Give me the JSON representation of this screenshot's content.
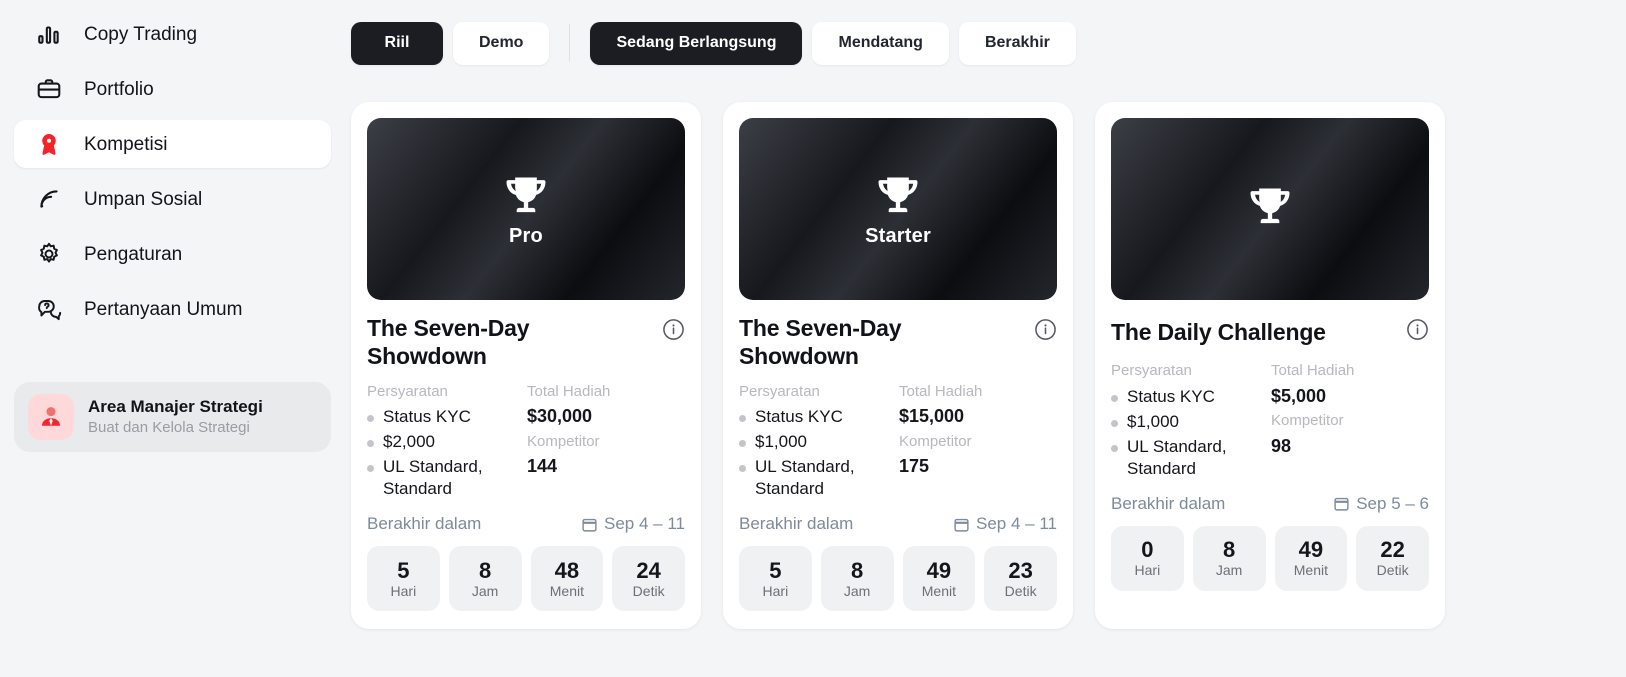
{
  "sidebar": {
    "items": [
      {
        "label": "Copy Trading",
        "icon": "bar-chart-icon",
        "active": false
      },
      {
        "label": "Portfolio",
        "icon": "briefcase-icon",
        "active": false
      },
      {
        "label": "Kompetisi",
        "icon": "award-ribbon-icon",
        "active": true
      },
      {
        "label": "Umpan Sosial",
        "icon": "rss-feed-icon",
        "active": false
      },
      {
        "label": "Pengaturan",
        "icon": "gear-icon",
        "active": false
      },
      {
        "label": "Pertanyaan Umum",
        "icon": "question-chat-icon",
        "active": false
      }
    ],
    "manager_card": {
      "title": "Area Manajer Strategi",
      "subtitle": "Buat dan Kelola Strategi",
      "icon": "manager-avatar-icon"
    },
    "active_color": "#ffffff",
    "accent_color": "#f5232a"
  },
  "tabs": {
    "mode": [
      {
        "label": "Riil",
        "active": true
      },
      {
        "label": "Demo",
        "active": false
      }
    ],
    "status": [
      {
        "label": "Sedang Berlangsung",
        "active": true
      },
      {
        "label": "Mendatang",
        "active": false
      },
      {
        "label": "Berakhir",
        "active": false
      }
    ]
  },
  "labels": {
    "requirements": "Persyaratan",
    "prize_pool": "Total Hadiah",
    "competitors": "Kompetitor",
    "ends_in": "Berakhir dalam",
    "days": "Hari",
    "hours": "Jam",
    "minutes": "Menit",
    "seconds": "Detik",
    "info_icon": "info-icon",
    "calendar_icon": "calendar-icon",
    "trophy_icon": "trophy-icon"
  },
  "cards": [
    {
      "tier": "Pro",
      "title": "The Seven-Day Showdown",
      "title_inline": false,
      "requirements": [
        "Status KYC",
        "$2,000",
        "UL Standard, Standard"
      ],
      "prize_pool": "$30,000",
      "competitors": "144",
      "date_range": "Sep 4 – 11",
      "countdown": {
        "days": "5",
        "hours": "8",
        "minutes": "48",
        "seconds": "24"
      }
    },
    {
      "tier": "Starter",
      "title": "The Seven-Day Showdown",
      "title_inline": false,
      "requirements": [
        "Status KYC",
        "$1,000",
        "UL Standard, Standard"
      ],
      "prize_pool": "$15,000",
      "competitors": "175",
      "date_range": "Sep 4 – 11",
      "countdown": {
        "days": "5",
        "hours": "8",
        "minutes": "49",
        "seconds": "23"
      }
    },
    {
      "tier": "",
      "title": "The Daily Challenge",
      "title_inline": true,
      "requirements": [
        "Status KYC",
        "$1,000",
        "UL Standard, Standard"
      ],
      "prize_pool": "$5,000",
      "competitors": "98",
      "date_range": "Sep 5 – 6",
      "countdown": {
        "days": "0",
        "hours": "8",
        "minutes": "49",
        "seconds": "22"
      }
    }
  ]
}
